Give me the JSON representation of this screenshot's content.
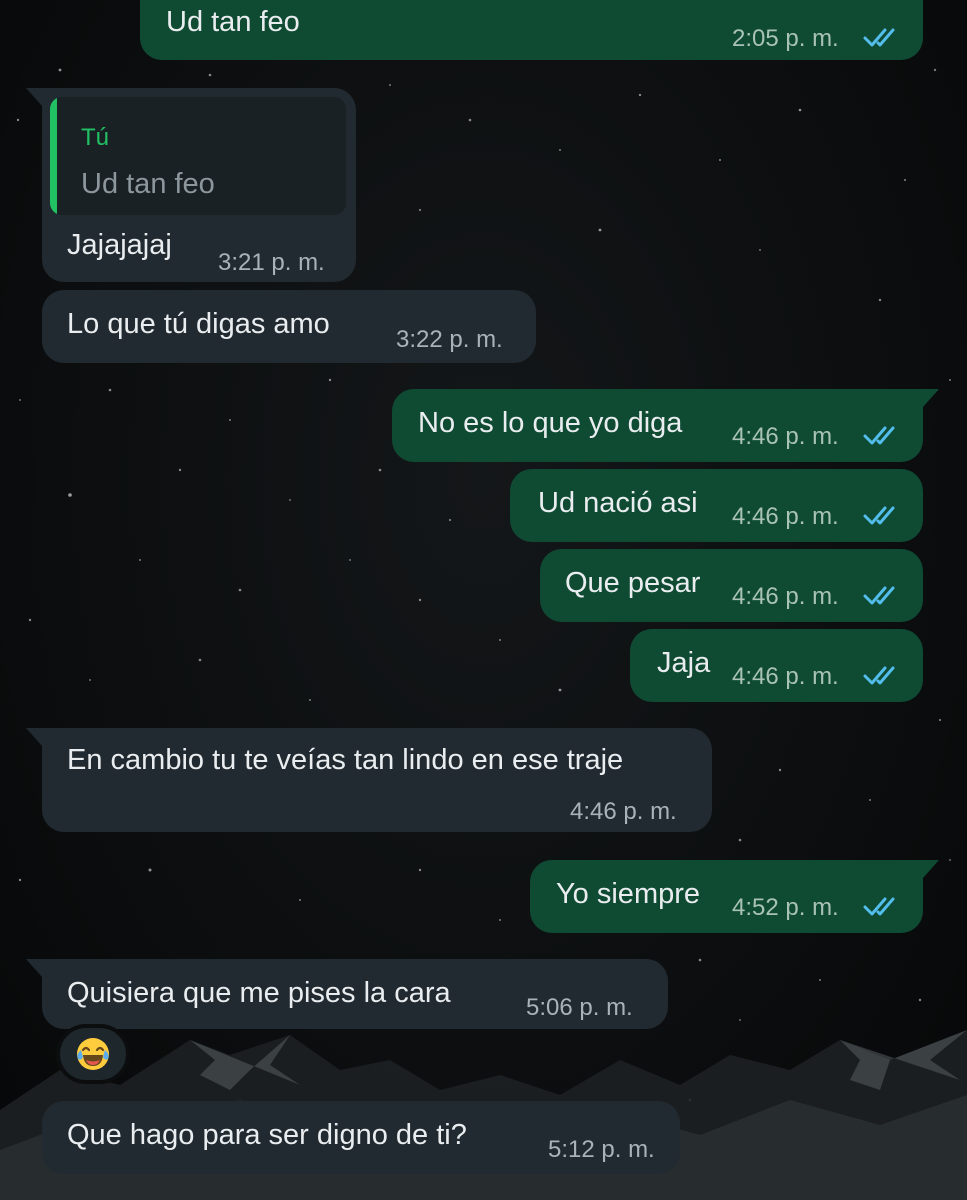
{
  "colors": {
    "outgoing_bubble": "#0f4a33",
    "incoming_bubble": "#212a30",
    "quote_accent": "#21c063",
    "read_ticks": "#53bdeb",
    "text": "#e9edef"
  },
  "messages": [
    {
      "direction": "out",
      "text": "Ud tan feo",
      "time": "2:05 p. m.",
      "status": "read"
    },
    {
      "direction": "in",
      "quote": {
        "author": "Tú",
        "text": "Ud tan feo"
      },
      "text": "Jajajajaj",
      "time": "3:21 p. m."
    },
    {
      "direction": "in",
      "text": "Lo que tú digas amo",
      "time": "3:22 p. m."
    },
    {
      "direction": "out",
      "text": "No es lo que yo diga",
      "time": "4:46 p. m.",
      "status": "read"
    },
    {
      "direction": "out",
      "text": "Ud nació asi",
      "time": "4:46 p. m.",
      "status": "read"
    },
    {
      "direction": "out",
      "text": "Que pesar",
      "time": "4:46 p. m.",
      "status": "read"
    },
    {
      "direction": "out",
      "text": "Jaja",
      "time": "4:46 p. m.",
      "status": "read"
    },
    {
      "direction": "in",
      "text": "En cambio tu te veías tan lindo en ese traje",
      "time": "4:46 p. m."
    },
    {
      "direction": "out",
      "text": "Yo siempre",
      "time": "4:52 p. m.",
      "status": "read"
    },
    {
      "direction": "in",
      "text": "Quisiera que me pises la cara",
      "time": "5:06 p. m.",
      "reaction": "tears-of-joy-emoji"
    },
    {
      "direction": "in",
      "text": "Que hago para ser digno de ti?",
      "time": "5:12 p. m."
    }
  ]
}
